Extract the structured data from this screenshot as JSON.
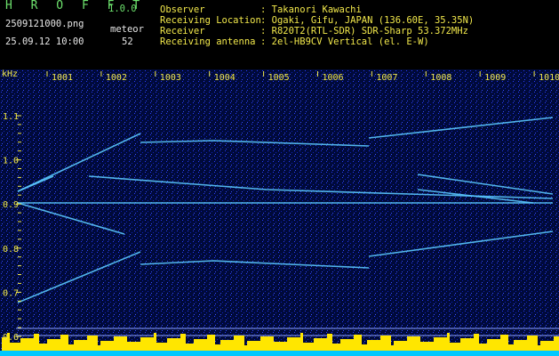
{
  "header": {
    "app_title": "H R O F F T",
    "version": "1.0.0",
    "filename": "2509121000.png",
    "detection_label": "meteor",
    "datetime": "25.09.12 10:00",
    "meteor_count": "52",
    "info": [
      {
        "label": "Observer",
        "value": ": Takanori Kawachi"
      },
      {
        "label": "Receiving Location",
        "value": ": Ogaki, Gifu, JAPAN (136.60E, 35.35N)"
      },
      {
        "label": "Receiver",
        "value": ": R820T2(RTL-SDR) SDR-Sharp 53.372MHz"
      },
      {
        "label": "Receiving antenna",
        "value": ": 2el-HB9CV Vertical (el. E-W)"
      }
    ]
  },
  "chart_data": {
    "type": "heatmap",
    "ylabel": "kHz",
    "y_ticks": [
      "1.1",
      "1.0",
      "0.9",
      "0.8",
      "0.7",
      "0.6"
    ],
    "x_ticks": [
      "1001",
      "1002",
      "1003",
      "1004",
      "1005",
      "1006",
      "1007",
      "1008",
      "1009",
      "1010"
    ],
    "colors": {
      "background": "#000a3a",
      "tick": "#f2e84b",
      "trace": "#5ac8ff",
      "meter_fill": "#ffe600",
      "meter_base": "#00c8ff"
    }
  }
}
